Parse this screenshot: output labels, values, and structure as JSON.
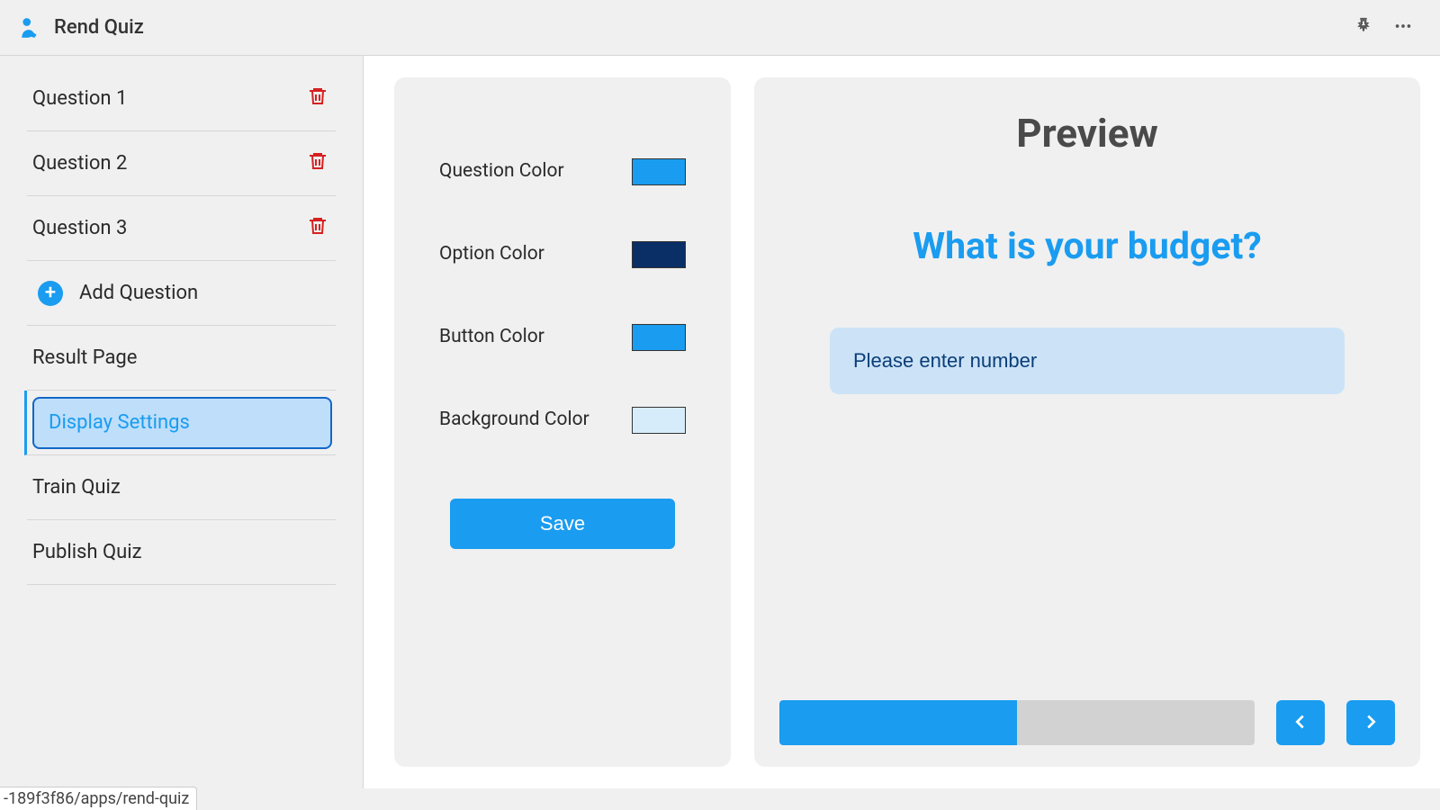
{
  "app": {
    "title": "Rend Quiz"
  },
  "sidebar": {
    "questions": [
      {
        "label": "Question 1"
      },
      {
        "label": "Question 2"
      },
      {
        "label": "Question 3"
      }
    ],
    "add_question_label": "Add Question",
    "result_page_label": "Result Page",
    "display_settings_label": "Display Settings",
    "train_quiz_label": "Train Quiz",
    "publish_quiz_label": "Publish Quiz"
  },
  "settings": {
    "question_color": {
      "label": "Question Color",
      "value": "#1a9cf0"
    },
    "option_color": {
      "label": "Option Color",
      "value": "#0a2f66"
    },
    "button_color": {
      "label": "Button Color",
      "value": "#1a9cf0"
    },
    "background_color": {
      "label": "Background Color",
      "value": "#d6ecfb"
    },
    "save_label": "Save"
  },
  "preview": {
    "title": "Preview",
    "question": "What is your budget?",
    "input_placeholder": "Please enter number",
    "progress_percent": 50
  },
  "status_text": "-189f3f86/apps/rend-quiz"
}
